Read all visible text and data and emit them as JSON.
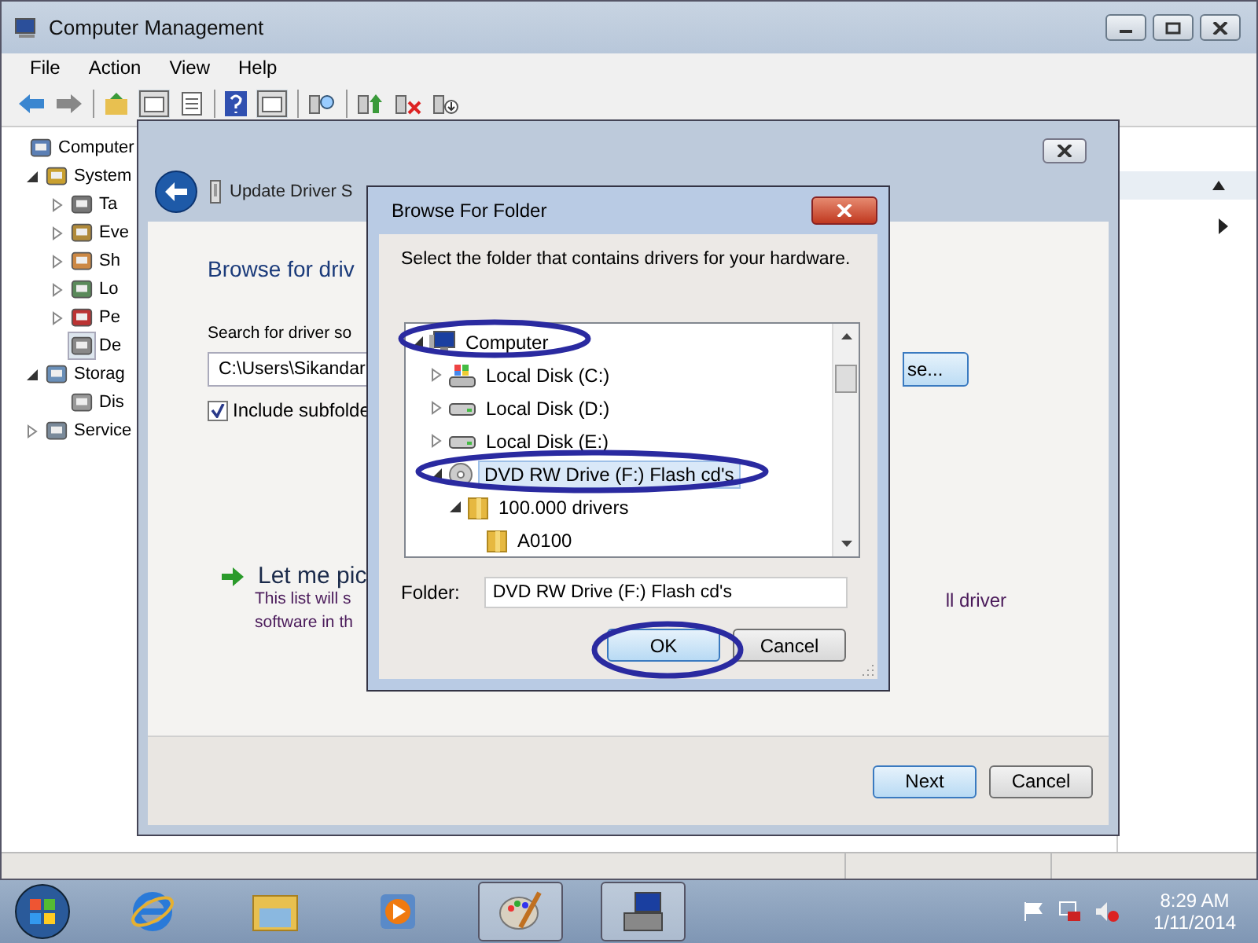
{
  "main_window": {
    "title": "Computer Management",
    "menu": [
      "File",
      "Action",
      "View",
      "Help"
    ],
    "tree": [
      {
        "label": "Computer",
        "expandable": false,
        "selected": false,
        "children": [
          {
            "label": "System",
            "expandable": true,
            "expanded": true,
            "selected": false,
            "children": [
              {
                "label": "Ta",
                "expandable": true,
                "expanded": false,
                "selected": false
              },
              {
                "label": "Eve",
                "expandable": true,
                "expanded": false,
                "selected": false
              },
              {
                "label": "Sh",
                "expandable": true,
                "expanded": false,
                "selected": false
              },
              {
                "label": "Lo",
                "expandable": true,
                "expanded": false,
                "selected": false
              },
              {
                "label": "Pe",
                "expandable": true,
                "expanded": false,
                "selected": false
              },
              {
                "label": "De",
                "expandable": false,
                "selected": true
              }
            ]
          },
          {
            "label": "Storag",
            "expandable": true,
            "expanded": true,
            "selected": false,
            "children": [
              {
                "label": "Dis",
                "expandable": false,
                "selected": false
              }
            ]
          },
          {
            "label": "Service",
            "expandable": true,
            "expanded": false,
            "selected": false
          }
        ]
      }
    ]
  },
  "wizard": {
    "title": "Update Driver S",
    "heading": "Browse for driv",
    "search_label": "Search for driver so",
    "path": "C:\\Users\\Sikandar",
    "include_subfolders": {
      "label": "Include subfolde",
      "checked": true
    },
    "browse_button": "se...",
    "option": {
      "title": "Let me pic",
      "line_1": "This list will s",
      "line_1_end": "ll driver",
      "line_2": "software in th"
    },
    "buttons": [
      "Next",
      "Cancel"
    ]
  },
  "dialog": {
    "title": "Browse For Folder",
    "instruction": "Select the folder that contains drivers for your hardware.",
    "tree": [
      {
        "label": "Computer",
        "kind": "computer",
        "expandable": true,
        "expanded": true,
        "selected": false,
        "children": [
          {
            "label": "Local Disk (C:)",
            "kind": "system-drive",
            "expandable": true,
            "expanded": false,
            "selected": false
          },
          {
            "label": "Local Disk (D:)",
            "kind": "drive",
            "expandable": true,
            "expanded": false,
            "selected": false
          },
          {
            "label": "Local Disk (E:)",
            "kind": "drive",
            "expandable": true,
            "expanded": false,
            "selected": false
          },
          {
            "label": "DVD RW Drive (F:) Flash cd's",
            "kind": "disc",
            "expandable": true,
            "expanded": true,
            "selected": true,
            "children": [
              {
                "label": "100.000 drivers",
                "kind": "folder",
                "expandable": true,
                "expanded": true,
                "selected": false,
                "children": [
                  {
                    "label": "A0100",
                    "kind": "folder",
                    "expandable": false,
                    "selected": false
                  }
                ]
              }
            ]
          }
        ]
      }
    ],
    "folder_label": "Folder:",
    "folder_value": "DVD RW Drive (F:) Flash cd's",
    "buttons": [
      "OK",
      "Cancel"
    ]
  },
  "taskbar": {
    "time": "8:29 AM",
    "date": "1/11/2014"
  }
}
